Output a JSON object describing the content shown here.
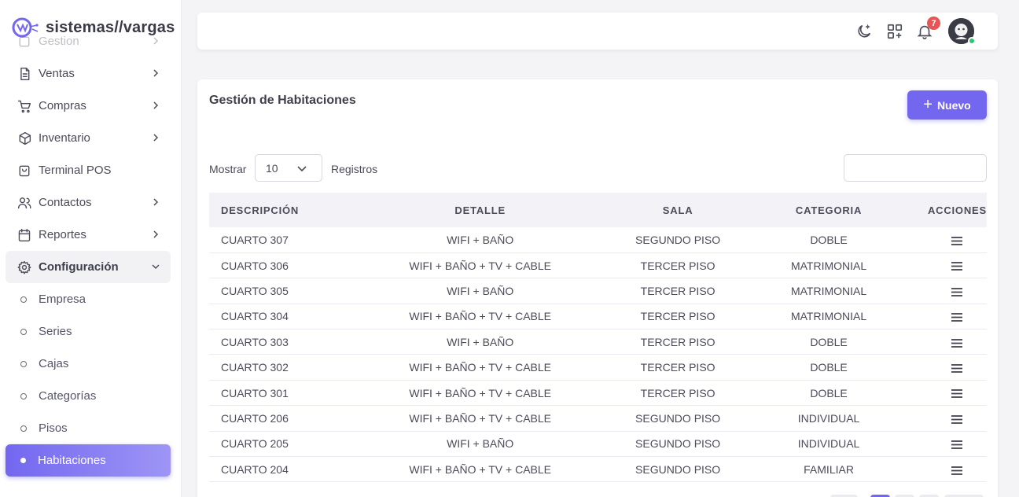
{
  "brand": {
    "name": "sistemas//vargas",
    "accent": "#7367f0"
  },
  "sidebar": {
    "items": [
      {
        "label": "Gestion",
        "icon": "square-icon",
        "faded": true,
        "chevron": true
      },
      {
        "label": "Ventas",
        "icon": "document-icon",
        "chevron": true
      },
      {
        "label": "Compras",
        "icon": "cart-icon",
        "chevron": true
      },
      {
        "label": "Inventario",
        "icon": "box-icon",
        "chevron": true
      },
      {
        "label": "Terminal POS",
        "icon": "shopping-bag-icon",
        "chevron": false
      },
      {
        "label": "Contactos",
        "icon": "users-icon",
        "chevron": true
      },
      {
        "label": "Reportes",
        "icon": "calendar-icon",
        "chevron": true
      },
      {
        "label": "Configuración",
        "icon": "gear-icon",
        "chevron": true,
        "open": true
      }
    ],
    "subitems": [
      {
        "label": "Empresa"
      },
      {
        "label": "Series"
      },
      {
        "label": "Cajas"
      },
      {
        "label": "Categorías"
      },
      {
        "label": "Pisos"
      },
      {
        "label": "Habitaciones",
        "active": true
      }
    ]
  },
  "topbar": {
    "icons": [
      "moon-icon",
      "grid-plus-icon",
      "bell-icon",
      "avatar"
    ],
    "notification_count": "7"
  },
  "main": {
    "title": "Gestión de Habitaciones",
    "new_button": "Nuevo",
    "show_label": "Mostrar",
    "page_size": "10",
    "records_label": "Registros",
    "search_value": ""
  },
  "table": {
    "columns": [
      "DESCRIPCIÓN",
      "DETALLE",
      "SALA",
      "CATEGORIA",
      "ACCIONES"
    ],
    "rows": [
      [
        "CUARTO 307",
        "WIFI + BAÑO",
        "SEGUNDO PISO",
        "DOBLE"
      ],
      [
        "CUARTO 306",
        "WIFI + BAÑO + TV + CABLE",
        "TERCER PISO",
        "MATRIMONIAL"
      ],
      [
        "CUARTO 305",
        "WIFI + BAÑO",
        "TERCER PISO",
        "MATRIMONIAL"
      ],
      [
        "CUARTO 304",
        "WIFI + BAÑO + TV + CABLE",
        "TERCER PISO",
        "MATRIMONIAL"
      ],
      [
        "CUARTO 303",
        "WIFI + BAÑO",
        "TERCER PISO",
        "DOBLE"
      ],
      [
        "CUARTO 302",
        "WIFI + BAÑO + TV + CABLE",
        "TERCER PISO",
        "DOBLE"
      ],
      [
        "CUARTO 301",
        "WIFI + BAÑO + TV + CABLE",
        "TERCER PISO",
        "DOBLE"
      ],
      [
        "CUARTO 206",
        "WIFI + BAÑO + TV + CABLE",
        "SEGUNDO PISO",
        "INDIVIDUAL"
      ],
      [
        "CUARTO 205",
        "WIFI + BAÑO",
        "SEGUNDO PISO",
        "INDIVIDUAL"
      ],
      [
        "CUARTO 204",
        "WIFI + BAÑO + TV + CABLE",
        "SEGUNDO PISO",
        "FAMILIAR"
      ]
    ]
  }
}
